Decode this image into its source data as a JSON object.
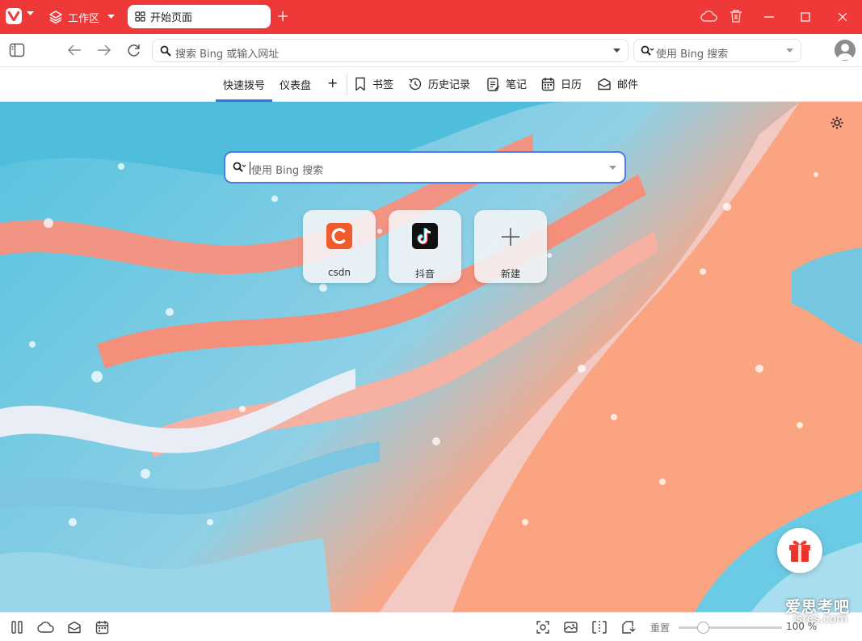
{
  "titlebar": {
    "workspace_label": "工作区",
    "tab_title": "开始页面",
    "icons": [
      "vivaldi-logo-icon",
      "chevron-down-icon",
      "layers-icon",
      "grid-icon",
      "plus-icon",
      "cloud-icon",
      "trash-icon",
      "minimize-icon",
      "maximize-icon",
      "close-icon"
    ]
  },
  "addressbar": {
    "url_placeholder": "搜索 Bing 或输入网址",
    "search_placeholder": "使用 Bing 搜索"
  },
  "startpage_nav": {
    "speed_dial": "快速拨号",
    "dashboard": "仪表盘",
    "bookmarks": "书签",
    "history": "历史记录",
    "notes": "笔记",
    "calendar": "日历",
    "mail": "邮件"
  },
  "main_search": {
    "placeholder": "使用 Bing 搜索"
  },
  "speed_dials": [
    {
      "label": "csdn",
      "color": "#f15a2b"
    },
    {
      "label": "抖音",
      "color": "#111111"
    },
    {
      "label": "新建"
    }
  ],
  "statusbar": {
    "reset_label": "重置",
    "zoom_level": "100 %",
    "zoom_fraction": 0.2
  },
  "watermark": {
    "line1": "爱思考吧",
    "line2": "isres.com"
  },
  "colors": {
    "accent_red": "#ef3939",
    "focus_blue": "#4a7be6"
  }
}
